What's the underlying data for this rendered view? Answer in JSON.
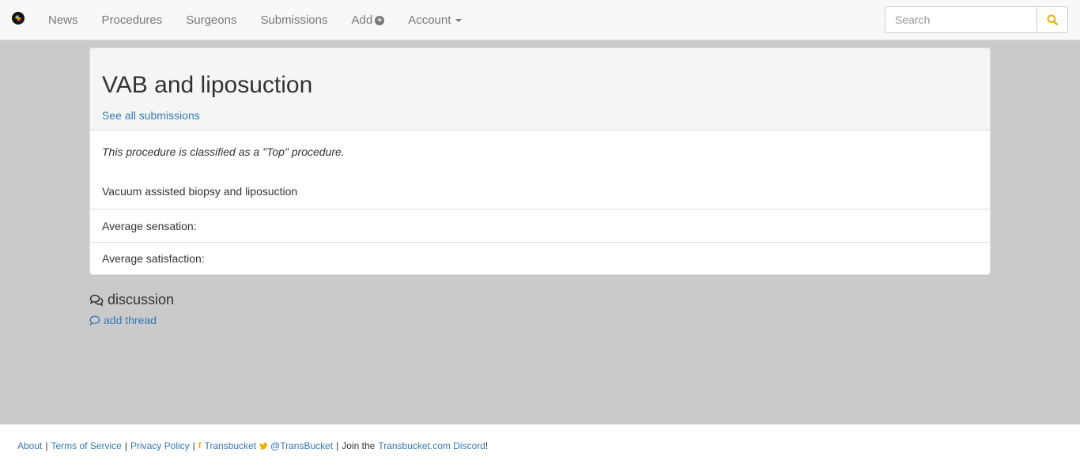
{
  "navbar": {
    "logo": "transbucket-logo",
    "items": [
      {
        "label": "News"
      },
      {
        "label": "Procedures"
      },
      {
        "label": "Surgeons"
      },
      {
        "label": "Submissions"
      },
      {
        "label": "Add",
        "icon": "plus-circle-icon"
      },
      {
        "label": "Account",
        "icon": "caret-down-icon"
      }
    ],
    "search": {
      "placeholder": "Search",
      "value": ""
    },
    "accent": "#f0ad00"
  },
  "procedure": {
    "title": "VAB and liposuction",
    "see_all": "See all submissions",
    "classification": "This procedure is classified as a \"Top\" procedure.",
    "description": "Vacuum assisted biopsy and liposuction",
    "average_sensation": "Average sensation:",
    "average_satisfaction": "Average satisfaction:"
  },
  "discussion": {
    "heading": "discussion",
    "add_thread": "add thread"
  },
  "footer": {
    "about": "About",
    "terms": "Terms of Service",
    "privacy": "Privacy Policy",
    "facebook": "Transbucket",
    "twitter": "@TransBucket",
    "join_text": "Join the",
    "discord": "Transbucket.com Discord",
    "exclaim": "!"
  }
}
